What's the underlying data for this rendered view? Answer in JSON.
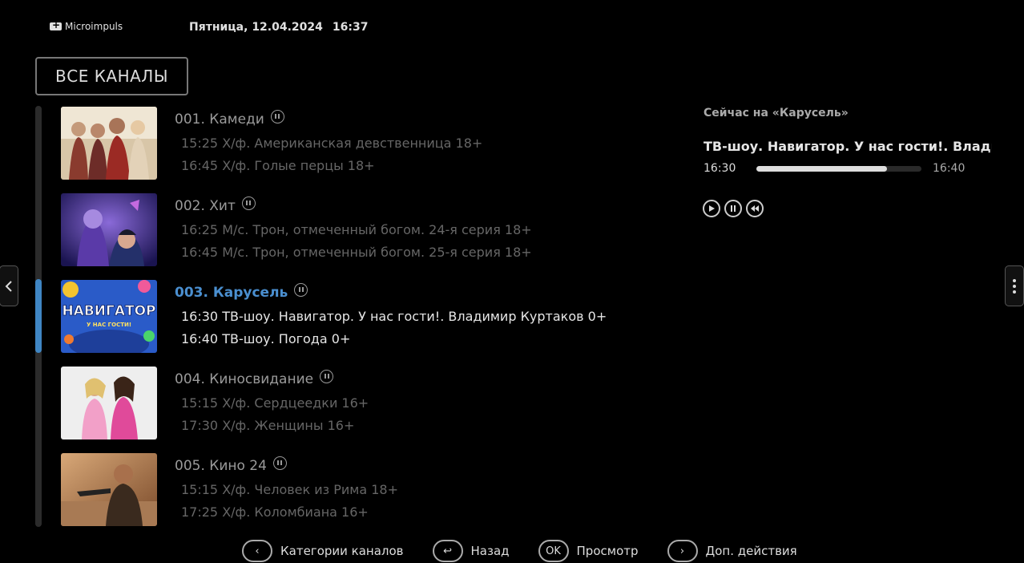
{
  "header": {
    "logo": "Microimpuls",
    "day": "Пятница, 12.04.2024",
    "time": "16:37"
  },
  "category_button": "ВСЕ КАНАЛЫ",
  "channels": [
    {
      "name": "001. Камеди",
      "p1": "15:25 Х/ф. Американская девственница  18+",
      "p2": "16:45 Х/ф. Голые перцы  18+"
    },
    {
      "name": "002. Хит",
      "p1": "16:25 М/с. Трон, отмеченный богом. 24-я серия  18+",
      "p2": "16:45 М/с. Трон, отмеченный богом. 25-я серия  18+"
    },
    {
      "name": "003. Карусель",
      "p1": "16:30 ТВ-шоу. Навигатор. У нас гости!. Владимир Куртаков  0+",
      "p2": "16:40 ТВ-шоу. Погода  0+"
    },
    {
      "name": "004. Киносвидание",
      "p1": "15:15 Х/ф. Сердцеедки  16+",
      "p2": "17:30 Х/ф. Женщины  16+"
    },
    {
      "name": "005. Кино 24",
      "p1": "15:15 Х/ф. Человек из Рима  18+",
      "p2": "17:25 Х/ф. Коломбиана  16+"
    }
  ],
  "now_panel": {
    "title": "Сейчас на «Карусель»",
    "show": "ТВ-шоу. Навигатор. У нас гости!. Влади...",
    "start": "16:30",
    "end": "16:40",
    "progress": 0.79,
    "controls": [
      "play-icon",
      "pause-icon",
      "rewind-icon"
    ]
  },
  "thumbnail_text": {
    "carousel_logo": "НАВИГАТОР",
    "carousel_sub": "У НАС ГОСТИ!"
  },
  "footer": [
    {
      "key": "‹",
      "label": "Категории каналов"
    },
    {
      "key": "↩",
      "label": "Назад"
    },
    {
      "key": "OK",
      "label": "Просмотр"
    },
    {
      "key": "›",
      "label": "Доп. действия"
    }
  ],
  "colors": {
    "accent": "#3f86c4",
    "background": "#000000"
  }
}
